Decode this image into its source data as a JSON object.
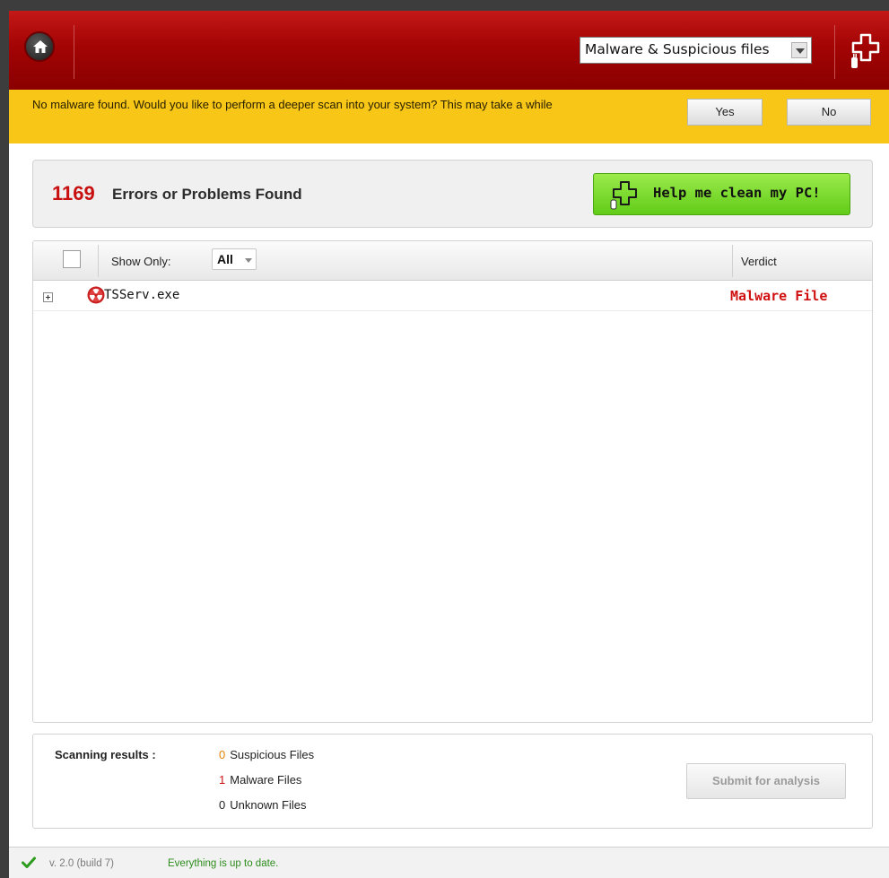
{
  "header": {
    "scan_type_value": "Malware & Suspicious files"
  },
  "notice": {
    "message": "No malware found. Would you like to perform a deeper scan into your system? This may take a while",
    "yes_label": "Yes",
    "no_label": "No"
  },
  "summary": {
    "count": "1169",
    "label": "Errors or Problems Found",
    "help_button": "Help me clean my PC!"
  },
  "table": {
    "show_only_label": "Show Only:",
    "filter_value": "All",
    "verdict_header": "Verdict",
    "rows": [
      {
        "name": "TSServ.exe",
        "verdict": "Malware File"
      }
    ]
  },
  "results": {
    "label": "Scanning results :",
    "suspicious_count": "0",
    "suspicious_label": "Suspicious Files",
    "malware_count": "1",
    "malware_label": "Malware Files",
    "unknown_count": "0",
    "unknown_label": "Unknown Files",
    "submit_label": "Submit for analysis"
  },
  "status": {
    "version": "v. 2.0 (build 7)",
    "update_text": "Everything is up to date."
  },
  "colors": {
    "header_red": "#a30404",
    "notice_yellow": "#f7c617",
    "error_red": "#c81010",
    "help_green": "#61cc18",
    "ok_green": "#2c8c1c"
  }
}
